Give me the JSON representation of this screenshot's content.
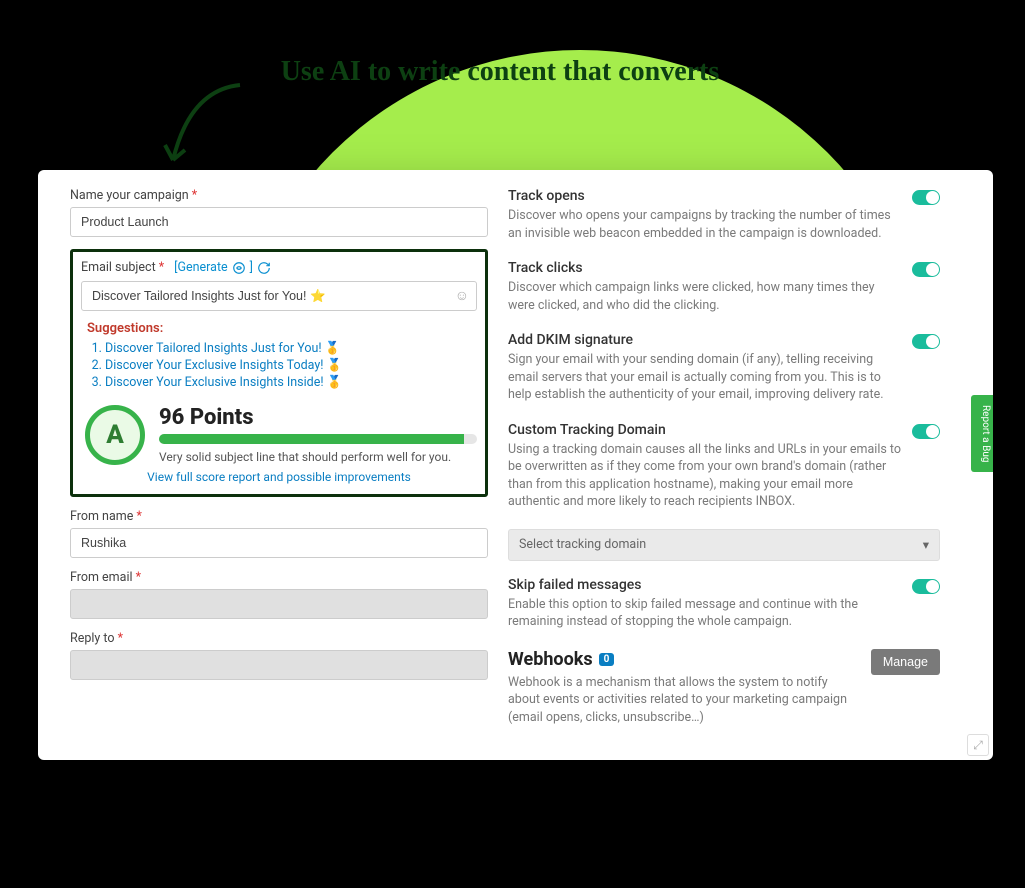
{
  "annotation": "Use AI to write content that converts",
  "left": {
    "campaign_label": "Name your campaign",
    "campaign_value": "Product Launch",
    "subject_label": "Email subject",
    "generate_label": "[Generate",
    "generate_suffix": "]",
    "subject_value": "Discover Tailored Insights Just for You! ⭐",
    "suggestions_title": "Suggestions:",
    "suggestions": [
      "Discover Tailored Insights Just for You! 🥇",
      "Discover Your Exclusive Insights Today! 🥇",
      "Discover Your Exclusive Insights Inside! 🥇"
    ],
    "grade": "A",
    "points_label": "96 Points",
    "score_pct": 96,
    "score_desc": "Very solid subject line that should perform well for you.",
    "score_link": "View full score report and possible improvements",
    "from_name_label": "From name",
    "from_name_value": "Rushika",
    "from_email_label": "From email",
    "reply_to_label": "Reply to"
  },
  "right": {
    "settings": [
      {
        "title": "Track opens",
        "desc": "Discover who opens your campaigns by tracking the number of times an invisible web beacon embedded in the campaign is downloaded."
      },
      {
        "title": "Track clicks",
        "desc": "Discover which campaign links were clicked, how many times they were clicked, and who did the clicking."
      },
      {
        "title": "Add DKIM signature",
        "desc": "Sign your email with your sending domain (if any), telling receiving email servers that your email is actually coming from you. This is to help establish the authenticity of your email, improving delivery rate."
      },
      {
        "title": "Custom Tracking Domain",
        "desc": "Using a tracking domain causes all the links and URLs in your emails to be overwritten as if they come from your own brand's domain (rather than from this application hostname), making your email more authentic and more likely to reach recipients INBOX."
      }
    ],
    "select_placeholder": "Select tracking domain",
    "skip": {
      "title": "Skip failed messages",
      "desc": "Enable this option to skip failed message and continue with the remaining instead of stopping the whole campaign."
    },
    "webhooks_title": "Webhooks",
    "webhooks_count": "0",
    "webhooks_desc": "Webhook is a mechanism that allows the system to notify about events or activities related to your marketing campaign (email opens, clicks, unsubscribe…)",
    "manage_label": "Manage",
    "report_bug_label": "Report a Bug"
  }
}
